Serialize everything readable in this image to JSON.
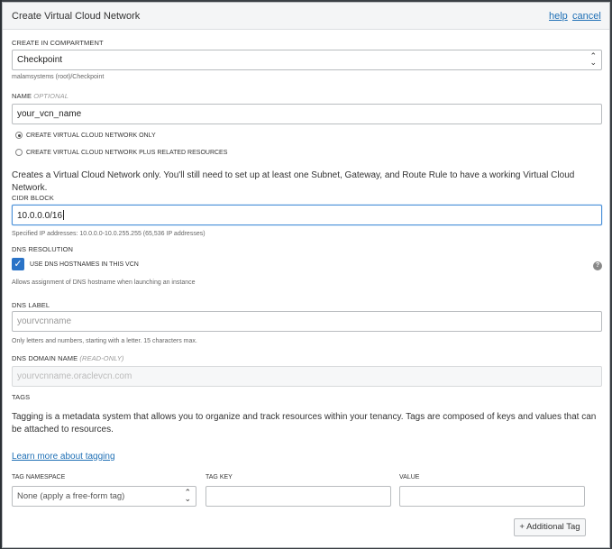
{
  "dialog": {
    "title": "Create Virtual Cloud Network",
    "help_label": "help",
    "cancel_label": "cancel"
  },
  "compartment": {
    "label": "CREATE IN COMPARTMENT",
    "value": "Checkpoint",
    "path": "malamsystems (root)/Checkpoint"
  },
  "name": {
    "label": "NAME",
    "optional": "OPTIONAL",
    "value": "your_vcn_name"
  },
  "radios": [
    {
      "label": "CREATE VIRTUAL CLOUD NETWORK ONLY",
      "selected": true
    },
    {
      "label": "CREATE VIRTUAL CLOUD NETWORK PLUS RELATED RESOURCES",
      "selected": false
    }
  ],
  "description": "Creates a Virtual Cloud Network only. You'll still need to set up at least one Subnet, Gateway, and Route Rule to have a working Virtual Cloud Network.",
  "cidr": {
    "label": "CIDR BLOCK",
    "value": "10.0.0.0/16",
    "hint": "Specified IP addresses: 10.0.0.0-10.0.255.255 (65,536 IP addresses)"
  },
  "dns_resolution": {
    "label": "DNS RESOLUTION",
    "checkbox_label": "USE DNS HOSTNAMES IN THIS VCN",
    "checked": true,
    "hint": "Allows assignment of DNS hostname when launching an instance"
  },
  "dns_label": {
    "label": "DNS LABEL",
    "placeholder": "yourvcnname",
    "hint": "Only letters and numbers, starting with a letter. 15 characters max."
  },
  "dns_domain": {
    "label": "DNS DOMAIN NAME",
    "readonly_tag": "(READ-ONLY)",
    "value": "yourvcnname.oraclevcn.com"
  },
  "tags": {
    "label": "TAGS",
    "description": "Tagging is a metadata system that allows you to organize and track resources within your tenancy. Tags are composed of keys and values that can be attached to resources.",
    "learn_more": "Learn more about tagging",
    "namespace_label": "TAG NAMESPACE",
    "namespace_value": "None (apply a free-form tag)",
    "key_label": "TAG KEY",
    "value_label": "VALUE",
    "add_button": "+ Additional Tag"
  },
  "colors": {
    "accent": "#1e6fb5",
    "checkbox": "#2a73c7",
    "focus": "#4a90d9"
  }
}
